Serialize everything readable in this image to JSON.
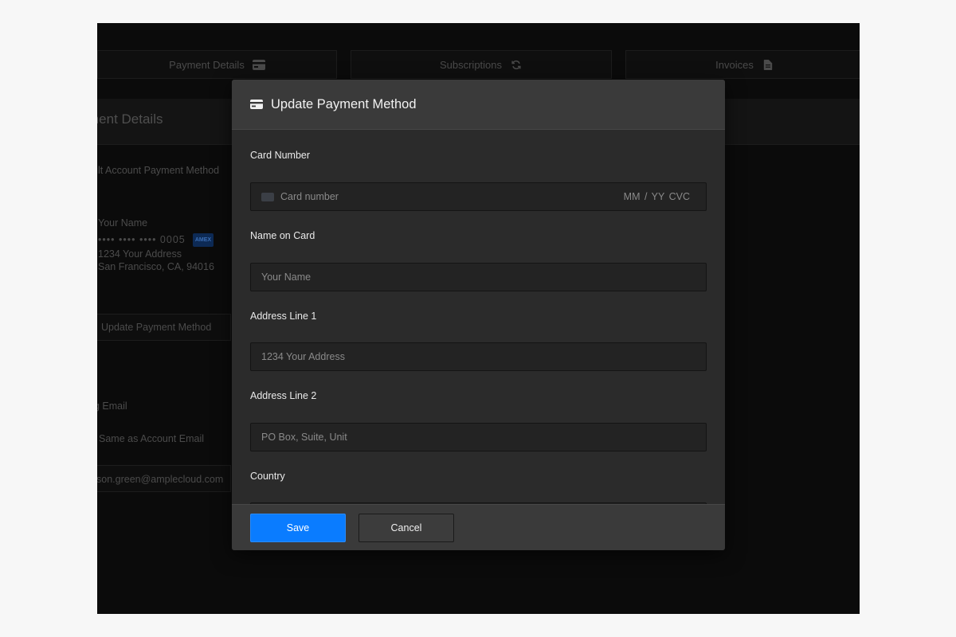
{
  "tabs": [
    {
      "label": "Payment Details",
      "icon": "credit-card-icon"
    },
    {
      "label": "Subscriptions",
      "icon": "refresh-icon"
    },
    {
      "label": "Invoices",
      "icon": "document-icon"
    }
  ],
  "background": {
    "section_title": "ment Details",
    "default_method_label": "ult Account Payment Method",
    "card_name": "Your Name",
    "card_number": "•••• •••• •••• 0005",
    "address_line": "1234 Your Address",
    "city_line": "San Francisco, CA, 94016",
    "card_brand": "AMEX",
    "update_button": "Update Payment Method",
    "billing_email_label": "g Email",
    "same_as_email": "Same as Account Email",
    "email_value": "son.green@amplecloud.com"
  },
  "modal": {
    "title": "Update Payment Method",
    "fields": {
      "card_number_label": "Card Number",
      "card_number_placeholder": "Card number",
      "card_expiry_cvc": "MM / YY  CVC",
      "name_label": "Name on Card",
      "name_placeholder": "Your Name",
      "address1_label": "Address Line 1",
      "address1_placeholder": "1234 Your Address",
      "address2_label": "Address Line 2",
      "address2_placeholder": "PO Box, Suite, Unit",
      "country_label": "Country"
    },
    "save_label": "Save",
    "cancel_label": "Cancel"
  },
  "colors": {
    "accent": "#0a7cff",
    "modal_bg": "#2b2b2b",
    "header_bg": "#3a3a3a"
  }
}
